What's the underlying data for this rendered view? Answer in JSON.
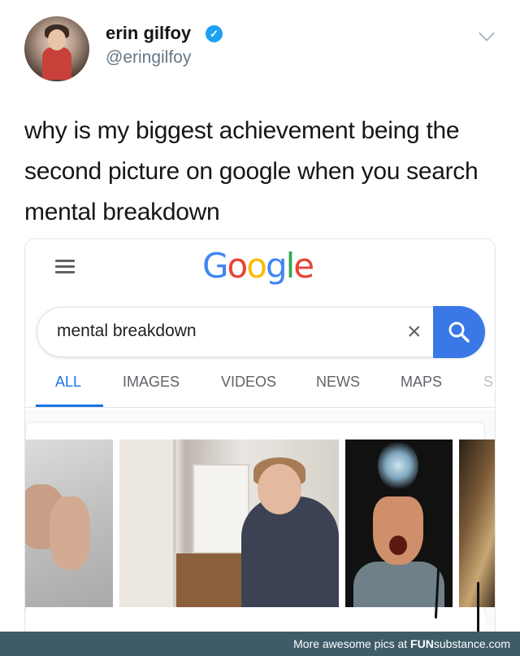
{
  "tweet": {
    "display_name": "erin gilfoy",
    "handle": "@eringilfoy",
    "verified_icon": "check-icon",
    "text": "why is my biggest achievement being the second picture on google  when you search mental breakdown"
  },
  "google": {
    "logo_letters": [
      "G",
      "o",
      "o",
      "g",
      "l",
      "e"
    ],
    "search_query": "mental breakdown",
    "clear_glyph": "×",
    "tabs": [
      "ALL",
      "IMAGES",
      "VIDEOS",
      "NEWS",
      "MAPS",
      "S"
    ],
    "active_tab": "ALL"
  },
  "footer": {
    "prefix": "More awesome pics at ",
    "brand_bold": "FUN",
    "brand_rest": "substance",
    "suffix": ".com"
  },
  "colors": {
    "link_blue": "#1a73e8",
    "search_button": "#3b78e7",
    "verified_blue": "#1da1f2",
    "footer_bg": "#3e5b68"
  }
}
